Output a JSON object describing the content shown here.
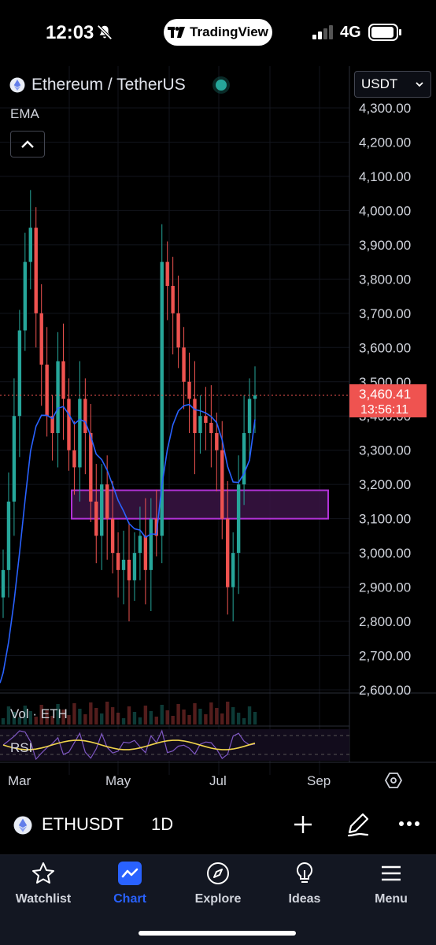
{
  "status_bar": {
    "time": "12:03",
    "app_badge": "TradingView",
    "network": "4G",
    "icons": [
      "bell-slash-icon",
      "tradingview-logo-icon",
      "signal-bars-icon",
      "battery-icon"
    ]
  },
  "chart_header": {
    "symbol_title": "Ethereum / TetherUS",
    "indicator": "EMA",
    "collapse_icon": "chevron-up-icon",
    "currency": "USDT",
    "live_color": "#26a69a"
  },
  "colors": {
    "up": "#26a69a",
    "down": "#ef5350",
    "ema": "#2962ff",
    "rsi": "#f2d64b",
    "zone_border": "#b132d6",
    "zone_fill": "#3a1444",
    "price_tag": "#ef5350"
  },
  "price_axis": {
    "ticks": [
      "4,300.00",
      "4,200.00",
      "4,100.00",
      "4,000.00",
      "3,900.00",
      "3,800.00",
      "3,700.00",
      "3,600.00",
      "3,500.00",
      "3,400.00",
      "3,300.00",
      "3,200.00",
      "3,100.00",
      "3,000.00",
      "2,900.00",
      "2,800.00",
      "2,700.00",
      "2,600.00"
    ],
    "last_price": "3,460.41",
    "countdown": "13:56:11"
  },
  "time_axis": {
    "labels": [
      "Mar",
      "May",
      "Jul",
      "Sep"
    ]
  },
  "panes": {
    "volume_label": "Vol · ETH",
    "rsi_label": "RSI"
  },
  "chart_data": {
    "type": "candlestick",
    "interval": "1D",
    "ylim": [
      2600,
      4300
    ],
    "y_unit": "USDT",
    "ema_end": 3390,
    "support_zone": [
      3100,
      3160
    ],
    "last_price": 3460.41,
    "closes": [
      2950,
      3150,
      3400,
      3650,
      3850,
      3950,
      3700,
      3550,
      3400,
      3350,
      3560,
      3450,
      3300,
      3250,
      3450,
      3350,
      3150,
      3050,
      3200,
      3100,
      3000,
      2950,
      2980,
      2920,
      3000,
      3050,
      2950,
      3100,
      3050,
      3850,
      3780,
      3700,
      3600,
      3500,
      3450,
      3350,
      3400,
      3380,
      3350,
      3300,
      3100,
      2900,
      3000,
      3200,
      3350,
      3450,
      3460
    ]
  }
}
